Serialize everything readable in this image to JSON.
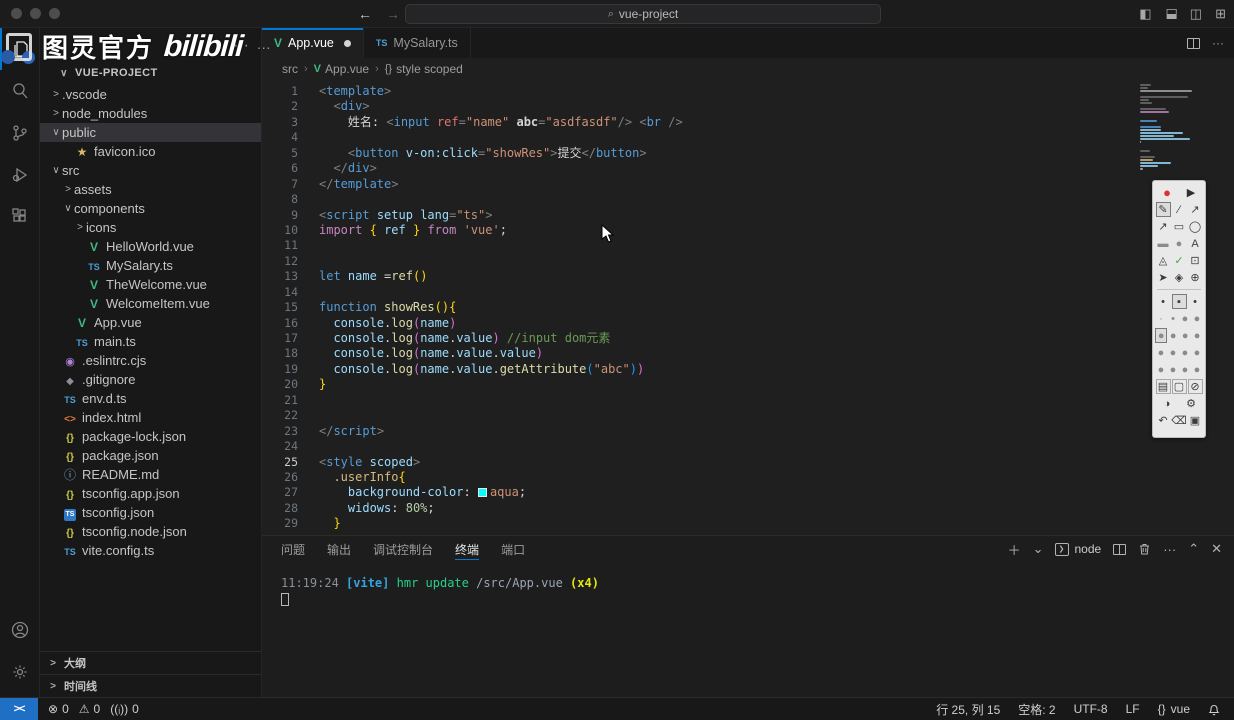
{
  "colors": {
    "accent": "#0078d4",
    "vue_green": "#41b883",
    "ts_blue": "#3178c6",
    "remote_blue": "#1f6fc5",
    "selection_bg": "#343438",
    "swatch_aqua": "#00ffff"
  },
  "titlebar": {
    "search_value": "vue-project",
    "search_icon": "⌕",
    "back": "←",
    "forward": "→"
  },
  "watermark": {
    "cn": "图灵官方",
    "logo": "bilibili",
    "dots": "···"
  },
  "sidebar": {
    "header_dots": "···",
    "title": "VUE-PROJECT",
    "tree": [
      {
        "label": ".vscode",
        "indent": 0,
        "chev": ">"
      },
      {
        "label": "node_modules",
        "indent": 0,
        "chev": ">"
      },
      {
        "label": "public",
        "indent": 0,
        "chev": "∨",
        "selected": true
      },
      {
        "label": "favicon.ico",
        "indent": 1,
        "icon": "star"
      },
      {
        "label": "src",
        "indent": 0,
        "chev": "∨"
      },
      {
        "label": "assets",
        "indent": 1,
        "chev": ">"
      },
      {
        "label": "components",
        "indent": 1,
        "chev": "∨"
      },
      {
        "label": "icons",
        "indent": 2,
        "chev": ">"
      },
      {
        "label": "HelloWorld.vue",
        "indent": 2,
        "icon": "vue"
      },
      {
        "label": "MySalary.ts",
        "indent": 2,
        "icon": "ts"
      },
      {
        "label": "TheWelcome.vue",
        "indent": 2,
        "icon": "vue"
      },
      {
        "label": "WelcomeItem.vue",
        "indent": 2,
        "icon": "vue"
      },
      {
        "label": "App.vue",
        "indent": 1,
        "icon": "vue"
      },
      {
        "label": "main.ts",
        "indent": 1,
        "icon": "ts"
      },
      {
        "label": ".eslintrc.cjs",
        "indent": 0,
        "icon": "eslint"
      },
      {
        "label": ".gitignore",
        "indent": 0,
        "icon": "git"
      },
      {
        "label": "env.d.ts",
        "indent": 0,
        "icon": "ts"
      },
      {
        "label": "index.html",
        "indent": 0,
        "icon": "html"
      },
      {
        "label": "package-lock.json",
        "indent": 0,
        "icon": "json"
      },
      {
        "label": "package.json",
        "indent": 0,
        "icon": "json"
      },
      {
        "label": "README.md",
        "indent": 0,
        "icon": "info"
      },
      {
        "label": "tsconfig.app.json",
        "indent": 0,
        "icon": "json"
      },
      {
        "label": "tsconfig.json",
        "indent": 0,
        "icon": "tsblue"
      },
      {
        "label": "tsconfig.node.json",
        "indent": 0,
        "icon": "json"
      },
      {
        "label": "vite.config.ts",
        "indent": 0,
        "icon": "ts"
      }
    ],
    "bottom_sections": [
      "大纲",
      "时间线"
    ]
  },
  "tabs": [
    {
      "label": "App.vue",
      "icon": "vue",
      "active": true,
      "dirty": true
    },
    {
      "label": "MySalary.ts",
      "icon": "ts",
      "active": false,
      "dirty": false
    }
  ],
  "tab_actions": {
    "split": "split",
    "more": "···"
  },
  "breadcrumb": [
    {
      "label": "src"
    },
    {
      "label": "App.vue",
      "icon": "vue"
    },
    {
      "label": "style scoped",
      "icon": "braces"
    }
  ],
  "editor": {
    "active_line": 25,
    "lines": [
      {
        "n": 1,
        "t": [
          [
            "<",
            "pun"
          ],
          [
            "template",
            "tag"
          ],
          [
            ">",
            "pun"
          ]
        ]
      },
      {
        "n": 2,
        "t": [
          [
            "  ",
            "txt"
          ],
          [
            "<",
            "pun"
          ],
          [
            "div",
            "tag"
          ],
          [
            ">",
            "pun"
          ]
        ]
      },
      {
        "n": 3,
        "t": [
          [
            "    姓名: ",
            "txt"
          ],
          [
            "<",
            "pun"
          ],
          [
            "input",
            "tag"
          ],
          [
            " ",
            "txt"
          ],
          [
            "ref",
            "refattr"
          ],
          [
            "=",
            "pun"
          ],
          [
            "\"name\"",
            "str"
          ],
          [
            " ",
            "txt"
          ],
          [
            "abc",
            "attrw"
          ],
          [
            "=",
            "pun"
          ],
          [
            "\"asdfasdf\"",
            "str"
          ],
          [
            "/>",
            "pun"
          ],
          [
            " ",
            "txt"
          ],
          [
            "<",
            "pun"
          ],
          [
            "br",
            "tag"
          ],
          [
            " />",
            "pun"
          ]
        ]
      },
      {
        "n": 4,
        "t": []
      },
      {
        "n": 5,
        "t": [
          [
            "    ",
            "txt"
          ],
          [
            "<",
            "pun"
          ],
          [
            "button",
            "tag"
          ],
          [
            " ",
            "txt"
          ],
          [
            "v-on:click",
            "attr"
          ],
          [
            "=",
            "pun"
          ],
          [
            "\"showRes\"",
            "str"
          ],
          [
            ">",
            "pun"
          ],
          [
            "提交",
            "txt"
          ],
          [
            "</",
            "pun"
          ],
          [
            "button",
            "tag"
          ],
          [
            ">",
            "pun"
          ]
        ]
      },
      {
        "n": 6,
        "t": [
          [
            "  ",
            "txt"
          ],
          [
            "</",
            "pun"
          ],
          [
            "div",
            "tag"
          ],
          [
            ">",
            "pun"
          ]
        ]
      },
      {
        "n": 7,
        "t": [
          [
            "</",
            "pun"
          ],
          [
            "template",
            "tag"
          ],
          [
            ">",
            "pun"
          ]
        ]
      },
      {
        "n": 8,
        "t": []
      },
      {
        "n": 9,
        "t": [
          [
            "<",
            "pun"
          ],
          [
            "script",
            "tag"
          ],
          [
            " ",
            "txt"
          ],
          [
            "setup",
            "attr"
          ],
          [
            " ",
            "txt"
          ],
          [
            "lang",
            "attr"
          ],
          [
            "=",
            "pun"
          ],
          [
            "\"ts\"",
            "str"
          ],
          [
            ">",
            "pun"
          ]
        ]
      },
      {
        "n": 10,
        "t": [
          [
            "import",
            "kwp"
          ],
          [
            " ",
            "txt"
          ],
          [
            "{",
            "b1"
          ],
          [
            " ",
            "txt"
          ],
          [
            "ref",
            "var"
          ],
          [
            " ",
            "txt"
          ],
          [
            "}",
            "b1"
          ],
          [
            " ",
            "txt"
          ],
          [
            "from",
            "kwp"
          ],
          [
            " ",
            "txt"
          ],
          [
            "'vue'",
            "str"
          ],
          [
            ";",
            "txt"
          ]
        ]
      },
      {
        "n": 11,
        "t": []
      },
      {
        "n": 12,
        "t": []
      },
      {
        "n": 13,
        "t": [
          [
            "let",
            "kw"
          ],
          [
            " ",
            "txt"
          ],
          [
            "name",
            "var"
          ],
          [
            " =",
            "txt"
          ],
          [
            "ref",
            "fn"
          ],
          [
            "(",
            "b1"
          ],
          [
            ")",
            "b1"
          ]
        ]
      },
      {
        "n": 14,
        "t": []
      },
      {
        "n": 15,
        "t": [
          [
            "function",
            "kw"
          ],
          [
            " ",
            "txt"
          ],
          [
            "showRes",
            "fn"
          ],
          [
            "(",
            "b1"
          ],
          [
            ")",
            "b1"
          ],
          [
            "{",
            "b1"
          ]
        ]
      },
      {
        "n": 16,
        "t": [
          [
            "  ",
            "txt"
          ],
          [
            "console",
            "var"
          ],
          [
            ".",
            "txt"
          ],
          [
            "log",
            "fn"
          ],
          [
            "(",
            "b2"
          ],
          [
            "name",
            "var"
          ],
          [
            ")",
            "b2"
          ]
        ]
      },
      {
        "n": 17,
        "t": [
          [
            "  ",
            "txt"
          ],
          [
            "console",
            "var"
          ],
          [
            ".",
            "txt"
          ],
          [
            "log",
            "fn"
          ],
          [
            "(",
            "b2"
          ],
          [
            "name",
            "var"
          ],
          [
            ".",
            "txt"
          ],
          [
            "value",
            "var"
          ],
          [
            ")",
            "b2"
          ],
          [
            " ",
            "txt"
          ],
          [
            "//input dom元素",
            "cmt"
          ]
        ]
      },
      {
        "n": 18,
        "t": [
          [
            "  ",
            "txt"
          ],
          [
            "console",
            "var"
          ],
          [
            ".",
            "txt"
          ],
          [
            "log",
            "fn"
          ],
          [
            "(",
            "b2"
          ],
          [
            "name",
            "var"
          ],
          [
            ".",
            "txt"
          ],
          [
            "value",
            "var"
          ],
          [
            ".",
            "txt"
          ],
          [
            "value",
            "var"
          ],
          [
            ")",
            "b2"
          ]
        ]
      },
      {
        "n": 19,
        "t": [
          [
            "  ",
            "txt"
          ],
          [
            "console",
            "var"
          ],
          [
            ".",
            "txt"
          ],
          [
            "log",
            "fn"
          ],
          [
            "(",
            "b2"
          ],
          [
            "name",
            "var"
          ],
          [
            ".",
            "txt"
          ],
          [
            "value",
            "var"
          ],
          [
            ".",
            "txt"
          ],
          [
            "getAttribute",
            "fn"
          ],
          [
            "(",
            "b3"
          ],
          [
            "\"abc\"",
            "str"
          ],
          [
            ")",
            "b3"
          ],
          [
            ")",
            "b2"
          ]
        ]
      },
      {
        "n": 20,
        "t": [
          [
            "}",
            "b1"
          ]
        ]
      },
      {
        "n": 21,
        "t": []
      },
      {
        "n": 22,
        "t": []
      },
      {
        "n": 23,
        "t": [
          [
            "</",
            "pun"
          ],
          [
            "script",
            "tag"
          ],
          [
            ">",
            "pun"
          ]
        ]
      },
      {
        "n": 24,
        "t": []
      },
      {
        "n": 25,
        "t": [
          [
            "<",
            "pun"
          ],
          [
            "style",
            "tag"
          ],
          [
            " ",
            "txt"
          ],
          [
            "scoped",
            "attr"
          ],
          [
            ">",
            "pun"
          ]
        ]
      },
      {
        "n": 26,
        "t": [
          [
            "  ",
            "txt"
          ],
          [
            ".userInfo",
            "sel"
          ],
          [
            "{",
            "b1"
          ]
        ]
      },
      {
        "n": 27,
        "t": [
          [
            "    ",
            "txt"
          ],
          [
            "background-color",
            "attr"
          ],
          [
            ": ",
            "txt"
          ],
          [
            "§",
            "swatch"
          ],
          [
            "aqua",
            "str"
          ],
          [
            ";",
            "txt"
          ]
        ]
      },
      {
        "n": 28,
        "t": [
          [
            "    ",
            "txt"
          ],
          [
            "widows",
            "attr"
          ],
          [
            ": ",
            "txt"
          ],
          [
            "80%",
            "num"
          ],
          [
            ";",
            "txt"
          ]
        ]
      },
      {
        "n": 29,
        "t": [
          [
            "  ",
            "txt"
          ],
          [
            "}",
            "b1"
          ]
        ]
      }
    ]
  },
  "panel": {
    "tabs": [
      "问题",
      "输出",
      "调试控制台",
      "终端",
      "端口"
    ],
    "active_tab": "终端",
    "actions": {
      "new": "＋",
      "dropdown": "⌄",
      "terminal_label": "node",
      "more": "···",
      "maximize": "⌃",
      "close": "✕"
    },
    "terminal_output": [
      [
        "11:19:24 ",
        "t-dim"
      ],
      [
        "[vite]",
        "t-cyan"
      ],
      [
        " hmr update ",
        "t-green"
      ],
      [
        "/src/App.vue ",
        "t-path"
      ],
      [
        "(x4)",
        "t-yellow"
      ]
    ]
  },
  "status_bar": {
    "remote_glyph": "><",
    "left": [
      {
        "icon": "⊗",
        "value": "0"
      },
      {
        "icon": "⚠",
        "value": "0"
      },
      {
        "icon": "((ᵢ))",
        "value": "0"
      }
    ],
    "right": [
      {
        "label": "行 25, 列 15"
      },
      {
        "label": "空格: 2"
      },
      {
        "label": "UTF-8"
      },
      {
        "label": "LF"
      },
      {
        "icon": "{}",
        "label": "vue"
      },
      {
        "icon": "bell",
        "label": ""
      }
    ]
  },
  "palette": {
    "rows": [
      {
        "items": [
          {
            "k": "record",
            "g": "●",
            "c": "pal-red"
          },
          {
            "k": "play",
            "g": "▶",
            "c": "pal-dark"
          }
        ]
      },
      {
        "items": [
          {
            "k": "pen",
            "g": "✎",
            "sel": true
          },
          {
            "k": "line",
            "g": "∕"
          },
          {
            "k": "arrow",
            "g": "↗"
          }
        ]
      },
      {
        "items": [
          {
            "k": "arrow-2",
            "g": "↗"
          },
          {
            "k": "rectangle",
            "g": "▭"
          },
          {
            "k": "ellipse",
            "g": "◯"
          }
        ]
      },
      {
        "items": [
          {
            "k": "rect-filled",
            "g": "▬",
            "c": "pal-gray"
          },
          {
            "k": "circle-filled",
            "g": "●",
            "c": "pal-gray"
          },
          {
            "k": "text",
            "g": "A"
          }
        ]
      },
      {
        "items": [
          {
            "k": "shape",
            "g": "◬"
          },
          {
            "k": "check",
            "g": "✓",
            "c": "pal-green"
          },
          {
            "k": "crop",
            "g": "⊡"
          }
        ]
      },
      {
        "items": [
          {
            "k": "select-cursor",
            "g": "➤"
          },
          {
            "k": "eraser",
            "g": "◈"
          },
          {
            "k": "magnifier",
            "g": "⊕"
          }
        ]
      },
      {
        "divider": true
      },
      {
        "items": [
          {
            "k": "size-small",
            "g": "•"
          },
          {
            "k": "size-medium",
            "g": "▪",
            "sel": true
          },
          {
            "k": "size-large",
            "g": "•"
          }
        ]
      },
      {
        "items": [
          {
            "k": "dot-1",
            "g": "·",
            "c": "pal-gray"
          },
          {
            "k": "dot-2",
            "g": "•",
            "c": "pal-gray"
          },
          {
            "k": "dot-3",
            "g": "●",
            "c": "pal-gray"
          },
          {
            "k": "dot-4",
            "g": "●",
            "c": "pal-gray"
          }
        ]
      },
      {
        "items": [
          {
            "k": "color-1",
            "g": "●",
            "c": "pal-gray",
            "sel": true
          },
          {
            "k": "color-2",
            "g": "●",
            "c": "pal-gray"
          },
          {
            "k": "color-3",
            "g": "●",
            "c": "pal-gray"
          },
          {
            "k": "color-4",
            "g": "●",
            "c": "pal-gray"
          }
        ]
      },
      {
        "items": [
          {
            "k": "color-5",
            "g": "●",
            "c": "pal-gray"
          },
          {
            "k": "color-6",
            "g": "●",
            "c": "pal-gray"
          },
          {
            "k": "color-7",
            "g": "●",
            "c": "pal-gray"
          },
          {
            "k": "color-8",
            "g": "●",
            "c": "pal-gray"
          }
        ]
      },
      {
        "items": [
          {
            "k": "color-9",
            "g": "●",
            "c": "pal-gray"
          },
          {
            "k": "color-10",
            "g": "●",
            "c": "pal-gray"
          },
          {
            "k": "color-11",
            "g": "●",
            "c": "pal-gray"
          },
          {
            "k": "color-12",
            "g": "●",
            "c": "pal-gray"
          }
        ]
      },
      {
        "items": [
          {
            "k": "blur",
            "g": "▤",
            "boxed": true
          },
          {
            "k": "dashed",
            "g": "▢",
            "boxed": true
          },
          {
            "k": "no-fill",
            "g": "⊘",
            "boxed": true
          }
        ]
      },
      {
        "items": [
          {
            "k": "contrast",
            "g": "◑"
          },
          {
            "k": "settings",
            "g": "⚙"
          }
        ]
      },
      {
        "items": [
          {
            "k": "undo",
            "g": "↶"
          },
          {
            "k": "trash",
            "g": "⌫"
          },
          {
            "k": "save-image",
            "g": "▣"
          }
        ]
      }
    ]
  }
}
